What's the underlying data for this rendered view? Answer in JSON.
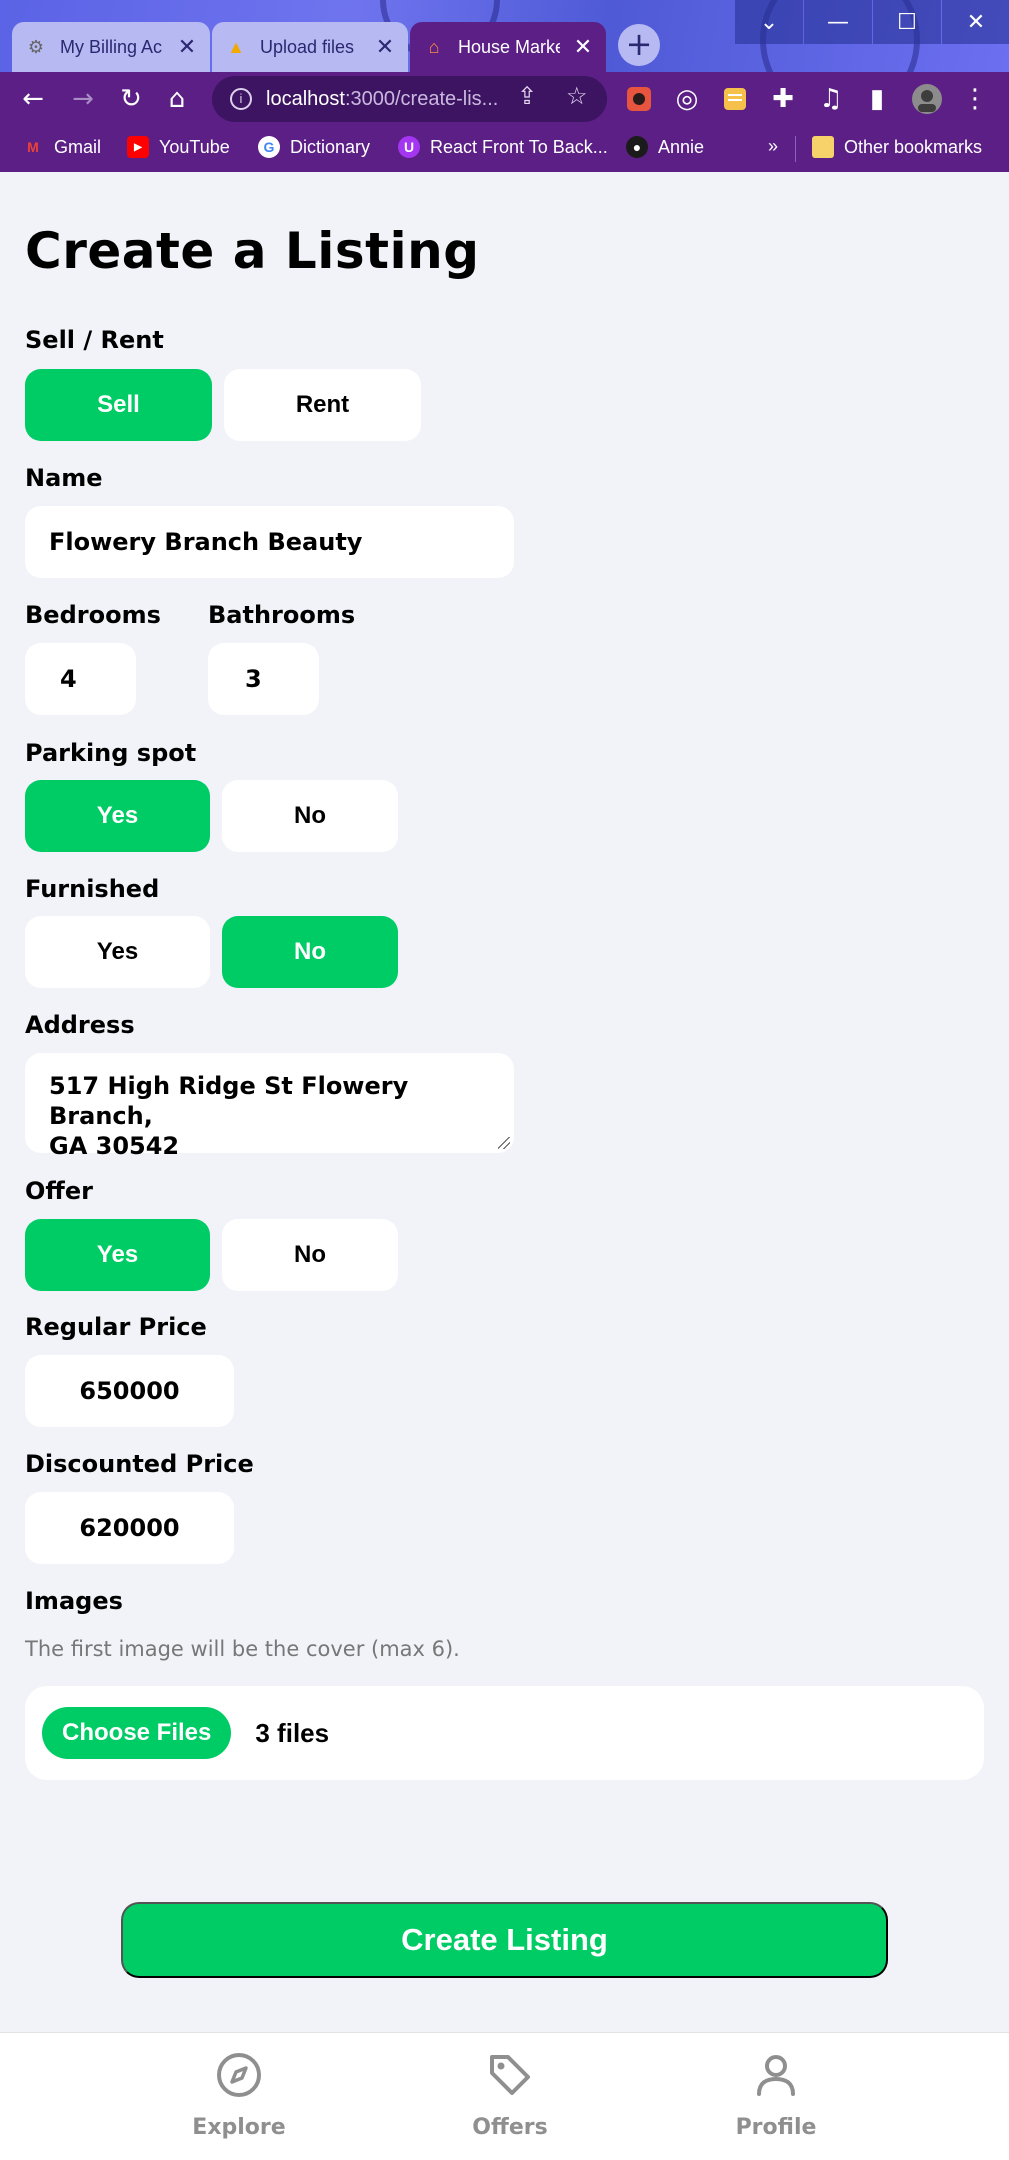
{
  "browser": {
    "tabs": [
      {
        "title": "My Billing Ac",
        "favicon": "gear-icon",
        "active": false
      },
      {
        "title": "Upload files",
        "favicon": "firebase-icon",
        "active": false
      },
      {
        "title": "House Marke",
        "favicon": "house-icon",
        "active": true
      }
    ],
    "url_host": "localhost",
    "url_path": ":3000/create-lis...",
    "bookmarks": [
      {
        "label": "Gmail",
        "icon": "gmail-icon"
      },
      {
        "label": "YouTube",
        "icon": "youtube-icon"
      },
      {
        "label": "Dictionary",
        "icon": "google-icon"
      },
      {
        "label": "React Front To Back...",
        "icon": "udemy-icon"
      },
      {
        "label": "Annie",
        "icon": "github-icon"
      }
    ],
    "overflow_label": "»",
    "other_bookmarks": "Other bookmarks"
  },
  "page": {
    "title": "Create a Listing",
    "sell_rent": {
      "label": "Sell / Rent",
      "option_sell": "Sell",
      "option_rent": "Rent",
      "selected": "Sell"
    },
    "name": {
      "label": "Name",
      "value": "Flowery Branch Beauty"
    },
    "bedrooms": {
      "label": "Bedrooms",
      "value": "4"
    },
    "bathrooms": {
      "label": "Bathrooms",
      "value": "3"
    },
    "parking": {
      "label": "Parking spot",
      "yes": "Yes",
      "no": "No",
      "selected": "Yes"
    },
    "furnished": {
      "label": "Furnished",
      "yes": "Yes",
      "no": "No",
      "selected": "No"
    },
    "address": {
      "label": "Address",
      "line1": "517 High Ridge St Flowery Branch,",
      "line2": "GA 30542"
    },
    "offer": {
      "label": "Offer",
      "yes": "Yes",
      "no": "No",
      "selected": "Yes"
    },
    "regular_price": {
      "label": "Regular Price",
      "value": "650000"
    },
    "discounted_price": {
      "label": "Discounted Price",
      "value": "620000"
    },
    "images": {
      "label": "Images",
      "hint": "The first image will be the cover (max 6).",
      "button": "Choose Files",
      "count": "3 files"
    },
    "submit": "Create Listing"
  },
  "navbar": {
    "items": [
      {
        "label": "Explore",
        "icon": "compass-icon"
      },
      {
        "label": "Offers",
        "icon": "tag-icon"
      },
      {
        "label": "Profile",
        "icon": "person-icon"
      }
    ]
  },
  "colors": {
    "accent": "#00cc66",
    "chrome": "#5c1f86",
    "page_bg": "#f1f3f8",
    "nav_text": "#8f8f8f"
  }
}
